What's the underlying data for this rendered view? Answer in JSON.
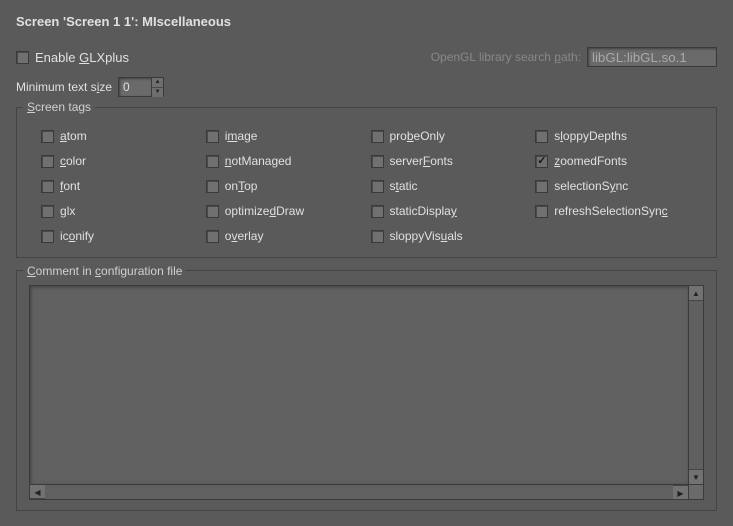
{
  "title": "Screen 'Screen 1 1': MIscellaneous",
  "enable_glxplus": {
    "label_pre": "Enable ",
    "label_u": "G",
    "label_post": "LXplus",
    "checked": false
  },
  "opengl_path": {
    "label_pre": "OpenGL library search ",
    "label_u": "p",
    "label_post": "ath:",
    "value": "libGL:libGL.so.1"
  },
  "min_text_size": {
    "label_pre": "Minimum text s",
    "label_u": "i",
    "label_post": "ze",
    "value": "0"
  },
  "groups": {
    "screen_tags": {
      "label_u": "S",
      "label_post": "creen tags"
    },
    "comment": {
      "label_u": "C",
      "label_mid": "omment in ",
      "label_u2": "c",
      "label_post": "onfiguration file"
    }
  },
  "tags": [
    {
      "u": "a",
      "rest": "tom",
      "checked": false
    },
    {
      "pre": "i",
      "u": "m",
      "rest": "age",
      "checked": false
    },
    {
      "pre": "pro",
      "u": "b",
      "rest": "eOnly",
      "checked": false
    },
    {
      "pre": "s",
      "u": "l",
      "rest": "oppyDepths",
      "checked": false
    },
    {
      "u": "c",
      "rest": "olor",
      "checked": false
    },
    {
      "u": "n",
      "rest": "otManaged",
      "checked": false
    },
    {
      "pre": "server",
      "u": "F",
      "rest": "onts",
      "checked": false
    },
    {
      "u": "z",
      "rest": "oomedFonts",
      "checked": true
    },
    {
      "u": "f",
      "rest": "ont",
      "checked": false
    },
    {
      "pre": "on",
      "u": "T",
      "rest": "op",
      "checked": false
    },
    {
      "pre": "s",
      "u": "t",
      "rest": "atic",
      "checked": false
    },
    {
      "pre": "selectionS",
      "u": "y",
      "rest": "nc",
      "checked": false
    },
    {
      "u": "g",
      "rest": "lx",
      "checked": false
    },
    {
      "pre": "optimize",
      "u": "d",
      "rest": "Draw",
      "checked": false
    },
    {
      "pre": "staticDispla",
      "u": "y",
      "rest": "",
      "checked": false
    },
    {
      "pre": "refreshSelectionSyn",
      "u": "c",
      "rest": "",
      "checked": false
    },
    {
      "pre": "ic",
      "u": "o",
      "rest": "nify",
      "checked": false
    },
    {
      "pre": "o",
      "u": "v",
      "rest": "erlay",
      "checked": false
    },
    {
      "pre": "sloppyVis",
      "u": "u",
      "rest": "als",
      "checked": false
    }
  ],
  "comment_value": ""
}
